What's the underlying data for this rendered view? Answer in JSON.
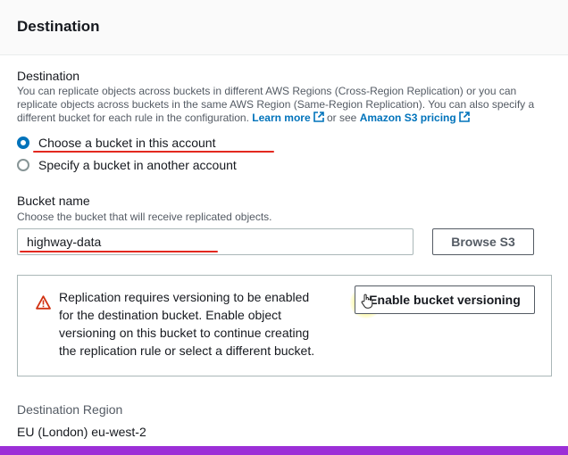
{
  "header": {
    "title": "Destination"
  },
  "destination": {
    "label": "Destination",
    "description_lines": [
      "You can replicate objects across buckets in different AWS Regions (Cross-Region Replication) or you can",
      "replicate objects across buckets in the same AWS Region (Same-Region Replication). You can also specify a"
    ],
    "description_line3_prefix": "different bucket for each rule in the configuration.",
    "learn_more": "Learn more",
    "or_see": "or see",
    "pricing_link": "Amazon S3 pricing",
    "options": [
      {
        "label": "Choose a bucket in this account",
        "selected": true
      },
      {
        "label": "Specify a bucket in another account",
        "selected": false
      }
    ]
  },
  "bucket": {
    "label": "Bucket name",
    "description": "Choose the bucket that will receive replicated objects.",
    "value": "highway-data",
    "browse_label": "Browse S3"
  },
  "alert": {
    "lines": [
      "Replication requires versioning to be enabled",
      "for the destination bucket. Enable object",
      "versioning on this bucket to continue creating",
      "the replication rule or select a different bucket."
    ],
    "button_label": "Enable bucket versioning"
  },
  "region": {
    "label": "Destination Region",
    "value": "EU (London) eu-west-2"
  },
  "colors": {
    "link": "#0073bb",
    "radio_selected": "#0073bb",
    "annotation_red": "#e3281f",
    "warning": "#d13212",
    "bottom_bar": "#9c2fd7"
  }
}
